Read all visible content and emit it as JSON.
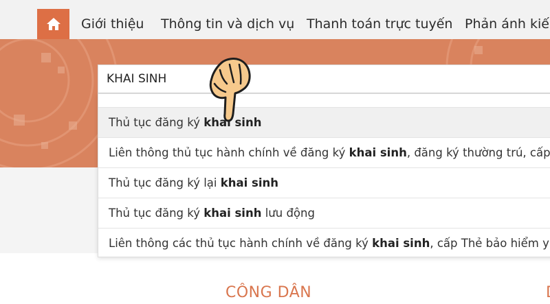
{
  "nav": {
    "home_icon": "home-icon",
    "items": [
      "Giới thiệu",
      "Thông tin và dịch vụ",
      "Thanh toán trực tuyến",
      "Phản ánh kiến"
    ]
  },
  "search": {
    "value": "KHAI SINH",
    "icon": "hand-pointer-icon"
  },
  "suggestions": [
    {
      "before": "Thủ tục đăng ký ",
      "bold": "khai sinh",
      "after": ""
    },
    {
      "before": "Liên thông thủ tục hành chính về đăng ký ",
      "bold": "khai sinh",
      "after": ", đăng ký thường trú, cấp thẻ"
    },
    {
      "before": "Thủ tục đăng ký lại ",
      "bold": "khai sinh",
      "after": ""
    },
    {
      "before": "Thủ tục đăng ký ",
      "bold": "khai sinh",
      "after": " lưu động"
    },
    {
      "before": "Liên thông các thủ tục hành chính về đăng ký ",
      "bold": "khai sinh",
      "after": ", cấp Thẻ bảo hiểm y tế ch"
    }
  ],
  "section": {
    "title": "CÔNG DÂN",
    "edge_text": "D"
  },
  "colors": {
    "accent": "#dd6f45",
    "banner": "#d9835e",
    "section_title": "#d9764e"
  }
}
